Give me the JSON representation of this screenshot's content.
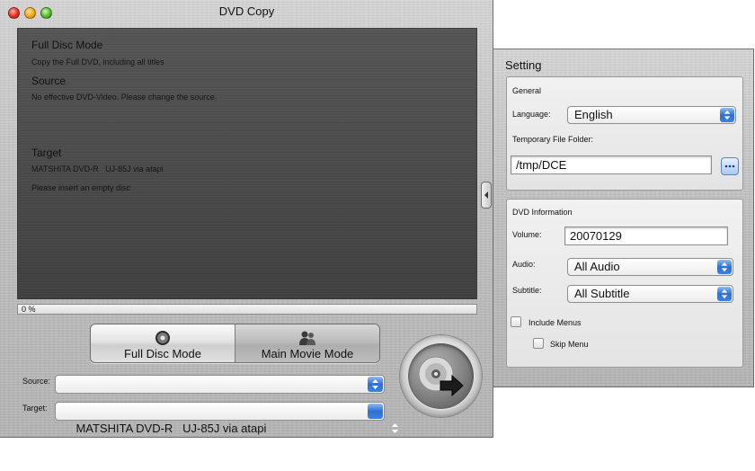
{
  "window": {
    "title": "DVD Copy"
  },
  "status": {
    "mode_heading": "Full Disc Mode",
    "mode_desc": "Copy the Full DVD, including all titles",
    "source_heading": "Source",
    "source_desc": "No effective DVD-Video. Please change the source.",
    "target_heading": "Target",
    "target_drive": "MATSHITA DVD-R   UJ-85J via atapi",
    "target_desc": "Please insert an empty disc"
  },
  "progress": {
    "label": "0 %",
    "fraction": 0
  },
  "modes": {
    "full_disc_label": "Full Disc Mode",
    "main_movie_label": "Main Movie Mode",
    "selected": "Main Movie Mode"
  },
  "source": {
    "label": "Source:",
    "value": ""
  },
  "target": {
    "label": "Target:",
    "value": "MATSHITA DVD-R   UJ-85J via atapi"
  },
  "settings": {
    "title": "Setting",
    "general": {
      "heading": "General",
      "language_label": "Language:",
      "language_value": "English",
      "temp_folder_label": "Temporary File Folder:",
      "temp_folder_value": "/tmp/DCE",
      "browse_label": "···"
    },
    "dvd_info": {
      "heading": "DVD Information",
      "volume_label": "Volume:",
      "volume_value": "20070129",
      "audio_label": "Audio:",
      "audio_value": "All Audio",
      "subtitle_label": "Subtitle:",
      "subtitle_value": "All Subtitle",
      "include_menus_label": "Include Menus",
      "include_menus_checked": false,
      "skip_menu_label": "Skip Menu",
      "skip_menu_checked": false
    }
  },
  "icons": {
    "close": "close-icon",
    "minimize": "minimize-icon",
    "zoom": "zoom-icon",
    "full_disc": "disc-icon",
    "main_movie": "people-icon",
    "copy": "disc-arrow-icon",
    "drawer": "triangle-left-icon",
    "popup": "updown-arrows-icon"
  },
  "colors": {
    "accent": "#2f6fd1",
    "status_panel": "#4b4b4b",
    "metal": "#c4c4c4"
  }
}
